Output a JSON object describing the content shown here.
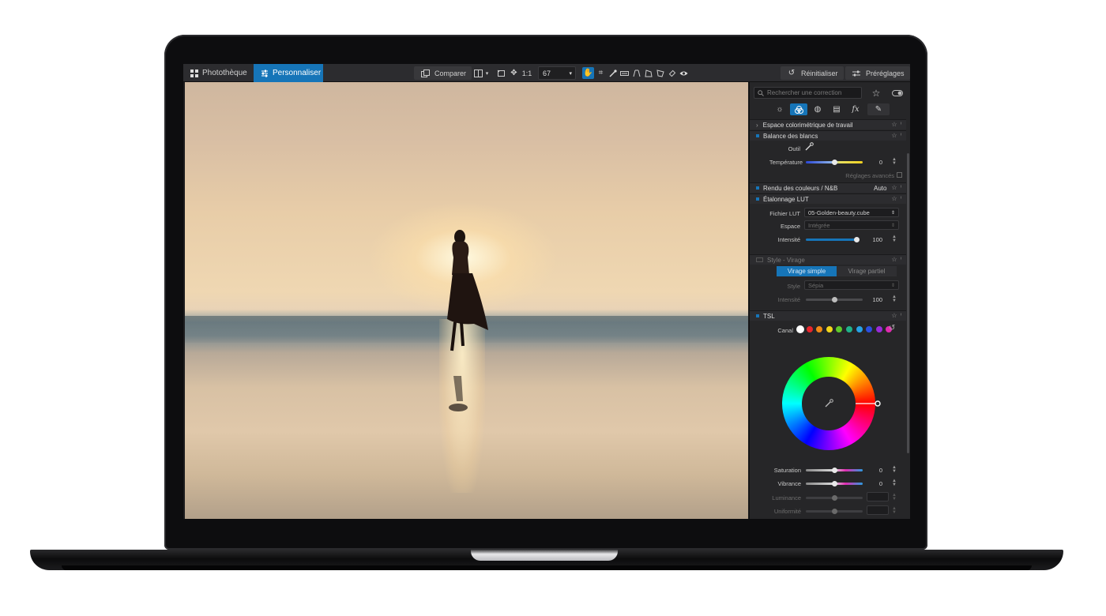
{
  "topbar": {
    "tabs": [
      {
        "label": "Photothèque",
        "icon": "grid-icon"
      },
      {
        "label": "Personnaliser",
        "icon": "sliders-icon"
      }
    ],
    "compare_label": "Comparer",
    "zoom_fit_label": "1:1",
    "zoom_value": "67",
    "reset_label": "Réinitialiser",
    "presets_label": "Préréglages"
  },
  "panel": {
    "search_placeholder": "Rechercher une correction",
    "sections": {
      "colorspace": "Espace colorimétrique de travail",
      "wb": "Balance des blancs",
      "color_render": "Rendu des couleurs / N&B",
      "color_render_value": "Auto",
      "lut": "Étalonnage LUT",
      "style": "Style - Virage",
      "tsl": "TSL"
    },
    "wb": {
      "tool_label": "Outil",
      "temp_label": "Température",
      "temp_value": "0",
      "temp_level": 0.5,
      "advanced_label": "Réglages avancés"
    },
    "lut": {
      "file_label": "Fichier LUT",
      "file_value": "05-Golden-beauty.cube",
      "space_label": "Espace",
      "space_value": "Intégrée",
      "intensity_label": "Intensité",
      "intensity_value": "100"
    },
    "style": {
      "seg_simple": "Virage simple",
      "seg_partial": "Virage partiel",
      "style_label": "Style",
      "style_value": "Sépia",
      "intensity_label": "Intensité",
      "intensity_value": "100"
    },
    "tsl": {
      "channel_label": "Canal",
      "channel_colors": [
        "#ffffff",
        "#e8252b",
        "#f08a16",
        "#f2d51b",
        "#5ec92b",
        "#1fb28b",
        "#27a2e6",
        "#2b4fe0",
        "#9a2bd8",
        "#e02bb0"
      ],
      "saturation_label": "Saturation",
      "saturation_value": "0",
      "vibrance_label": "Vibrance",
      "vibrance_value": "0",
      "luminance_label": "Luminance",
      "uniformity_label": "Uniformité"
    }
  },
  "colors": {
    "accent": "#1675b8",
    "panel_bg": "#262628",
    "topbar_bg": "#2c2c2f"
  }
}
